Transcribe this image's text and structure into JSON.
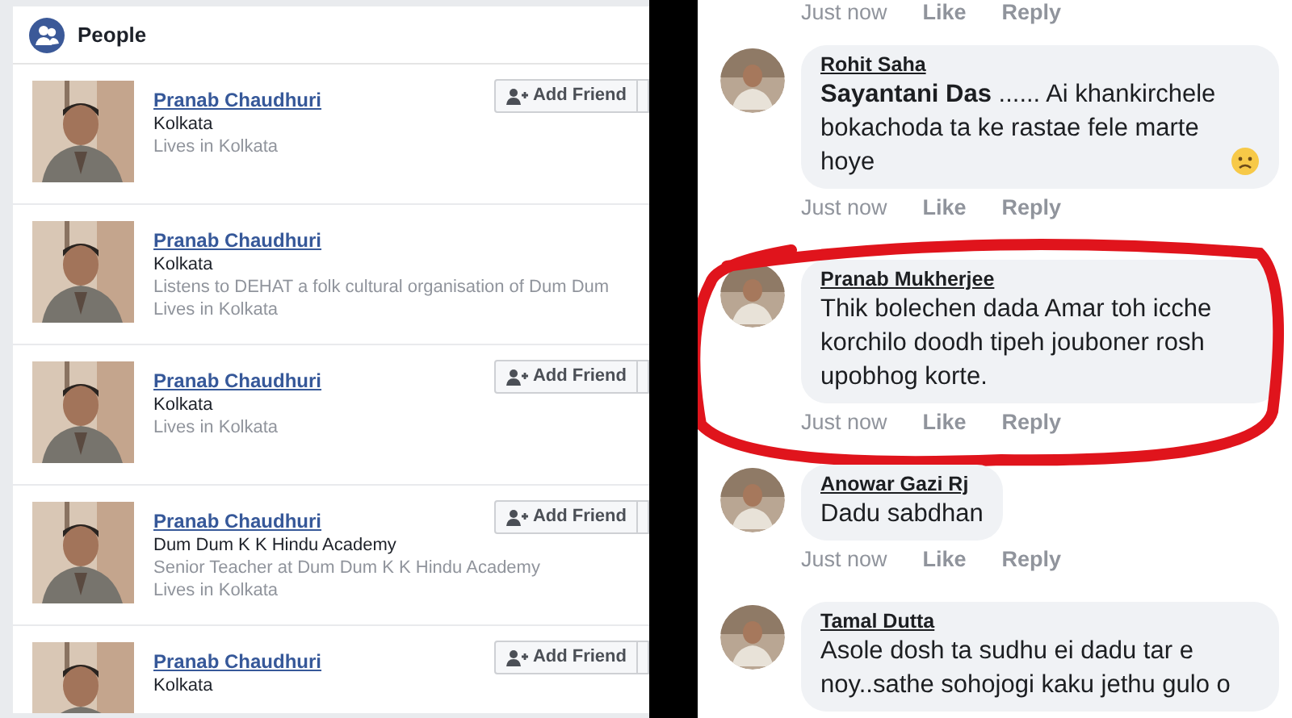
{
  "people_panel": {
    "title": "People",
    "results": [
      {
        "name": "Pranab Chaudhuri",
        "lines": [
          "Kolkata",
          "Lives in Kolkata"
        ],
        "button": "Add Friend"
      },
      {
        "name": "Pranab Chaudhuri",
        "lines": [
          "Kolkata",
          "Listens to DEHAT a folk cultural organisation of Dum Dum",
          "Lives in Kolkata"
        ]
      },
      {
        "name": "Pranab Chaudhuri",
        "lines": [
          "Kolkata",
          "Lives in Kolkata"
        ],
        "button": "Add Friend"
      },
      {
        "name": "Pranab Chaudhuri",
        "lines": [
          "Dum Dum K K Hindu Academy",
          "Senior Teacher at Dum Dum K K Hindu Academy",
          "Lives in Kolkata"
        ],
        "button": "Add Friend"
      },
      {
        "name": "Pranab Chaudhuri",
        "lines": [
          "Kolkata"
        ],
        "button": "Add Friend"
      }
    ]
  },
  "comments_panel": {
    "top_actions": [
      "Just now",
      "Like",
      "Reply"
    ],
    "comments": [
      {
        "author": "Rohit Saha",
        "text": "**Sayantani Das** ...... Ai khankirchele bokachoda ta ke rastae fele marte hoye",
        "sad_emoji": true,
        "actions": [
          "Just now",
          "Like",
          "Reply"
        ],
        "highlighted": false
      },
      {
        "author": "Pranab Mukherjee",
        "text": "Thik bolechen dada Amar toh icche korchilo doodh tipeh jouboner rosh upobhog korte.",
        "actions": [
          "Just now",
          "Like",
          "Reply"
        ],
        "highlighted": true
      },
      {
        "author": "Anowar Gazi Rj",
        "text": "Dadu sabdhan",
        "actions": [
          "Just now",
          "Like",
          "Reply"
        ],
        "highlighted": false
      },
      {
        "author": "Tamal Dutta",
        "text": "Asole dosh ta sudhu ei dadu tar e noy..sathe sohojogi kaku jethu gulo o",
        "highlighted": false
      }
    ]
  }
}
